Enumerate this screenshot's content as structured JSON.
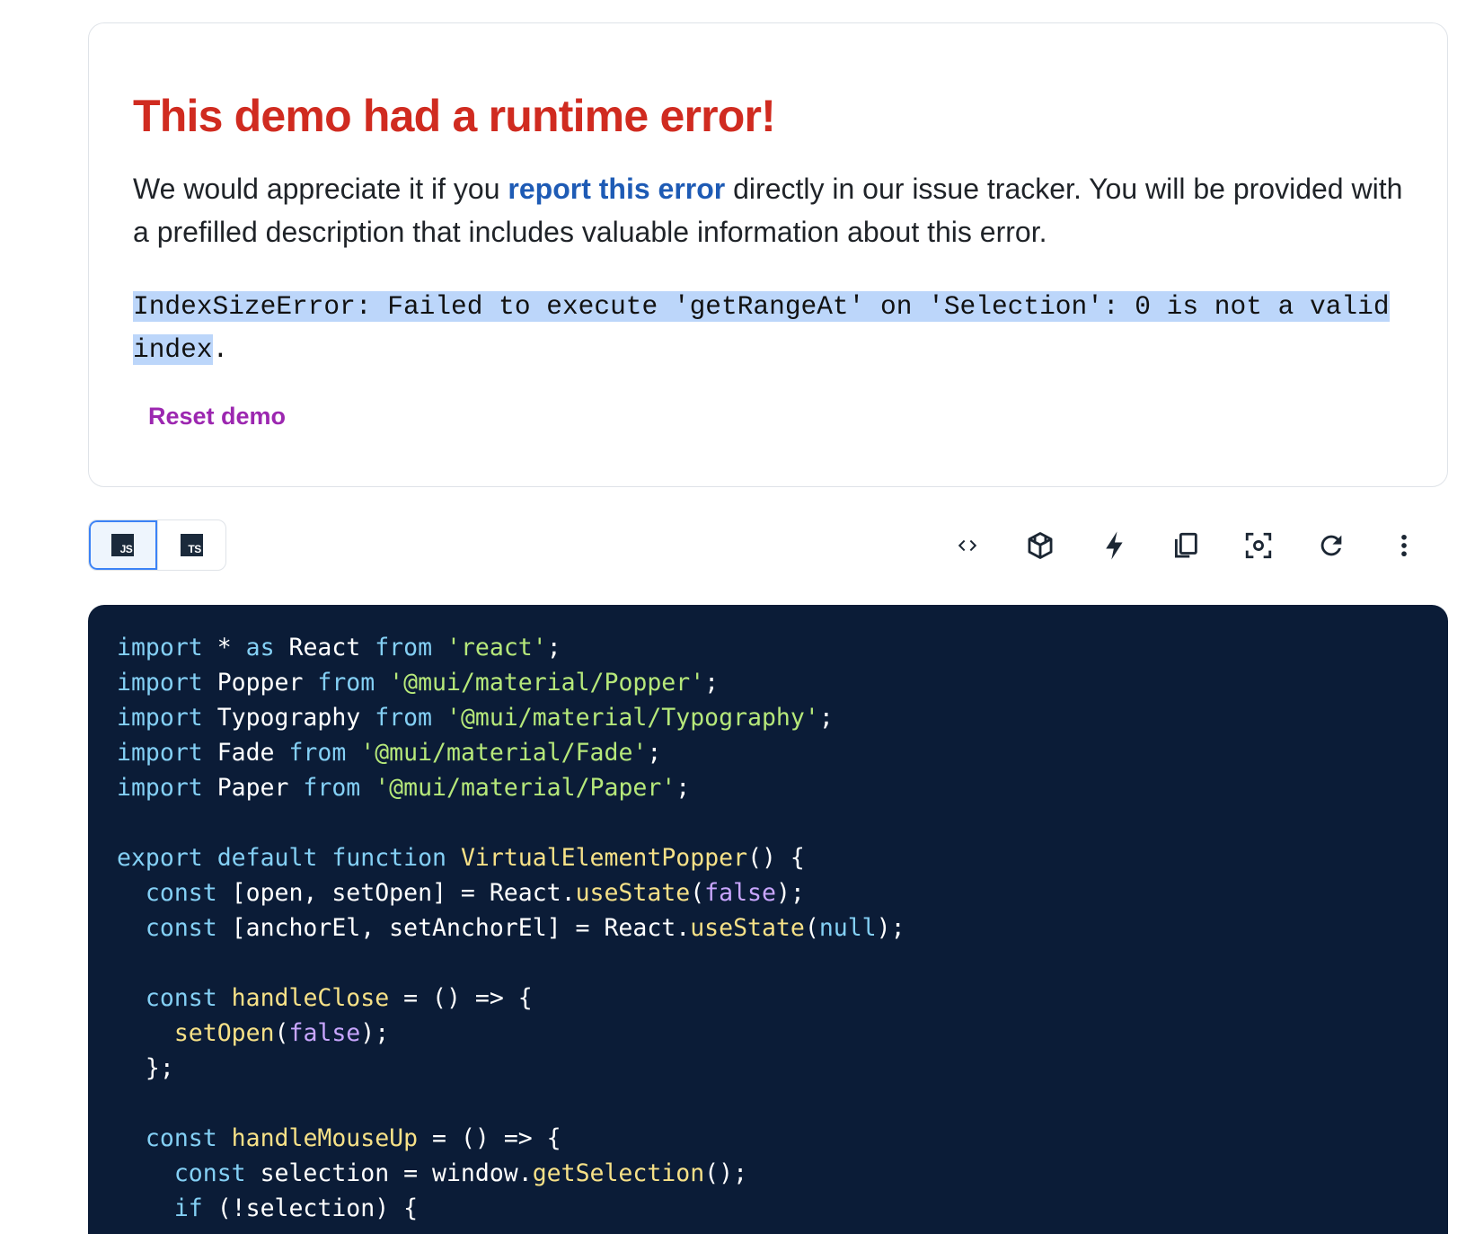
{
  "error": {
    "title": "This demo had a runtime error!",
    "desc_before": "We would appreciate it if you ",
    "desc_link": "report this error",
    "desc_after": " directly in our issue tracker. You will be provided with a prefilled description that includes valuable information about this error.",
    "message_selected_1": "IndexSizeError: Failed to execute 'getRangeAt' on 'Selection': 0 is not a valid index",
    "message_end": ".",
    "reset_label": "Reset demo"
  },
  "lang_toggle": {
    "js_label": "JS",
    "ts_label": "TS",
    "active": "JS"
  },
  "toolbar": {
    "icons": [
      "code-icon",
      "codesandbox-icon",
      "stackblitz-icon",
      "copy-icon",
      "focus-icon",
      "reset-icon",
      "more-vert-icon"
    ]
  },
  "colors": {
    "error_title": "#d02b20",
    "link": "#1e5bb5",
    "selection": "#bcd6fa",
    "reset": "#9c27b0",
    "code_bg": "#0b1c37",
    "keyword": "#84d0f5",
    "string": "#b6e87a",
    "function": "#f7e187",
    "literal": "#c9a6ff"
  },
  "code_lines": [
    [
      [
        "kw",
        "import"
      ],
      [
        "p",
        " * "
      ],
      [
        "kw",
        "as"
      ],
      [
        "p",
        " React "
      ],
      [
        "kw",
        "from"
      ],
      [
        "p",
        " "
      ],
      [
        "str",
        "'react'"
      ],
      [
        "p",
        ";"
      ]
    ],
    [
      [
        "kw",
        "import"
      ],
      [
        "p",
        " Popper "
      ],
      [
        "kw",
        "from"
      ],
      [
        "p",
        " "
      ],
      [
        "str",
        "'@mui/material/Popper'"
      ],
      [
        "p",
        ";"
      ]
    ],
    [
      [
        "kw",
        "import"
      ],
      [
        "p",
        " Typography "
      ],
      [
        "kw",
        "from"
      ],
      [
        "p",
        " "
      ],
      [
        "str",
        "'@mui/material/Typography'"
      ],
      [
        "p",
        ";"
      ]
    ],
    [
      [
        "kw",
        "import"
      ],
      [
        "p",
        " Fade "
      ],
      [
        "kw",
        "from"
      ],
      [
        "p",
        " "
      ],
      [
        "str",
        "'@mui/material/Fade'"
      ],
      [
        "p",
        ";"
      ]
    ],
    [
      [
        "kw",
        "import"
      ],
      [
        "p",
        " Paper "
      ],
      [
        "kw",
        "from"
      ],
      [
        "p",
        " "
      ],
      [
        "str",
        "'@mui/material/Paper'"
      ],
      [
        "p",
        ";"
      ]
    ],
    [],
    [
      [
        "kw",
        "export"
      ],
      [
        "p",
        " "
      ],
      [
        "kw",
        "default"
      ],
      [
        "p",
        " "
      ],
      [
        "kw",
        "function"
      ],
      [
        "p",
        " "
      ],
      [
        "fn",
        "VirtualElementPopper"
      ],
      [
        "p",
        "() {"
      ]
    ],
    [
      [
        "p",
        "  "
      ],
      [
        "kw",
        "const"
      ],
      [
        "p",
        " [open, setOpen] = React."
      ],
      [
        "fn",
        "useState"
      ],
      [
        "p",
        "("
      ],
      [
        "lit",
        "false"
      ],
      [
        "p",
        ");"
      ]
    ],
    [
      [
        "p",
        "  "
      ],
      [
        "kw",
        "const"
      ],
      [
        "p",
        " [anchorEl, setAnchorEl] = React."
      ],
      [
        "fn",
        "useState"
      ],
      [
        "p",
        "("
      ],
      [
        "kw",
        "null"
      ],
      [
        "p",
        ");"
      ]
    ],
    [],
    [
      [
        "p",
        "  "
      ],
      [
        "kw",
        "const"
      ],
      [
        "p",
        " "
      ],
      [
        "fn",
        "handleClose"
      ],
      [
        "p",
        " = () => {"
      ]
    ],
    [
      [
        "p",
        "    "
      ],
      [
        "fn",
        "setOpen"
      ],
      [
        "p",
        "("
      ],
      [
        "lit",
        "false"
      ],
      [
        "p",
        ");"
      ]
    ],
    [
      [
        "p",
        "  };"
      ]
    ],
    [],
    [
      [
        "p",
        "  "
      ],
      [
        "kw",
        "const"
      ],
      [
        "p",
        " "
      ],
      [
        "fn",
        "handleMouseUp"
      ],
      [
        "p",
        " = () => {"
      ]
    ],
    [
      [
        "p",
        "    "
      ],
      [
        "kw",
        "const"
      ],
      [
        "p",
        " selection = window."
      ],
      [
        "fn",
        "getSelection"
      ],
      [
        "p",
        "();"
      ]
    ],
    [
      [
        "p",
        "    "
      ],
      [
        "kw",
        "if"
      ],
      [
        "p",
        " (!selection) {"
      ]
    ]
  ]
}
